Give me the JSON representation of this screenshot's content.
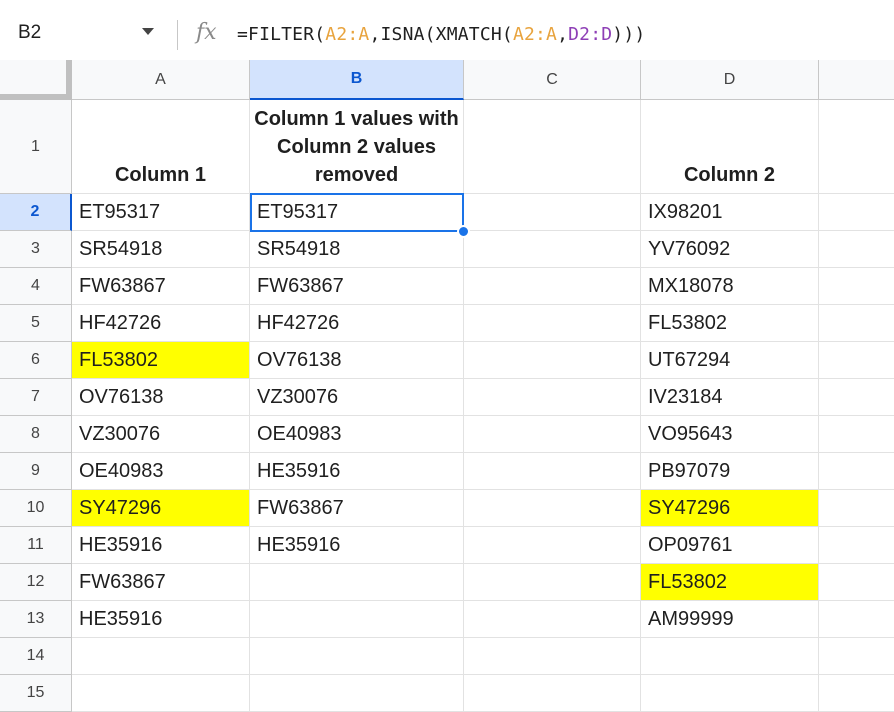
{
  "formula_bar": {
    "name_box": "B2",
    "fx_icon": "function-icon",
    "formula_parts": [
      "=FILTER(",
      "A2:A",
      ",ISNA(XMATCH(",
      "A2:A",
      ",",
      "D2:D",
      ")))"
    ]
  },
  "columns": [
    "A",
    "B",
    "C",
    "D"
  ],
  "rows": [
    "1",
    "2",
    "3",
    "4",
    "5",
    "6",
    "7",
    "8",
    "9",
    "10",
    "11",
    "12",
    "13",
    "14",
    "15"
  ],
  "header_row": {
    "a": "Column 1",
    "b": "Column 1 values with Column 2 values removed",
    "c": "",
    "d": "Column 2"
  },
  "cells": [
    {
      "a": "ET95317",
      "b": "ET95317",
      "d": "IX98201"
    },
    {
      "a": "SR54918",
      "b": "SR54918",
      "d": "YV76092"
    },
    {
      "a": "FW63867",
      "b": "FW63867",
      "d": "MX18078"
    },
    {
      "a": "HF42726",
      "b": "HF42726",
      "d": "FL53802"
    },
    {
      "a": "FL53802",
      "b": "OV76138",
      "d": "UT67294"
    },
    {
      "a": "OV76138",
      "b": "VZ30076",
      "d": "IV23184"
    },
    {
      "a": "VZ30076",
      "b": "OE40983",
      "d": "VO95643"
    },
    {
      "a": "OE40983",
      "b": "HE35916",
      "d": "PB97079"
    },
    {
      "a": "SY47296",
      "b": "FW63867",
      "d": "SY47296"
    },
    {
      "a": "HE35916",
      "b": "HE35916",
      "d": "OP09761"
    },
    {
      "a": "FW63867",
      "b": "",
      "d": "FL53802"
    },
    {
      "a": "HE35916",
      "b": "",
      "d": "AM99999"
    },
    {
      "a": "",
      "b": "",
      "d": ""
    },
    {
      "a": "",
      "b": "",
      "d": ""
    }
  ],
  "selection": {
    "cell": "B2",
    "selected_column": "B",
    "selected_row": "2"
  },
  "highlighted_cells": [
    "A6",
    "A10",
    "D10",
    "D12"
  ],
  "colors": {
    "highlight": "#ffff00",
    "selection": "#1a73e8",
    "range_a": "#e8a33d",
    "range_d": "#8e3fb6"
  }
}
